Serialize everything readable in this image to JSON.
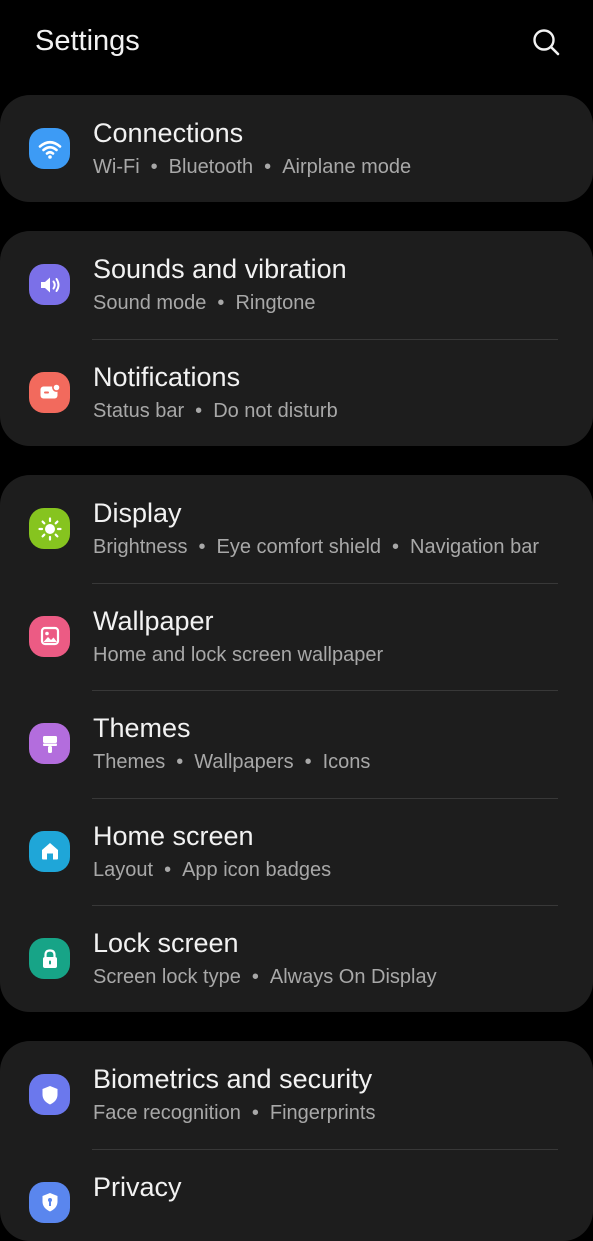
{
  "header": {
    "title": "Settings",
    "search_icon": "search-icon"
  },
  "groups": [
    {
      "items": [
        {
          "title": "Connections",
          "subtitle": [
            "Wi-Fi",
            "Bluetooth",
            "Airplane mode"
          ],
          "icon": "wifi-icon",
          "color": "#3d9bf5"
        }
      ]
    },
    {
      "items": [
        {
          "title": "Sounds and vibration",
          "subtitle": [
            "Sound mode",
            "Ringtone"
          ],
          "icon": "speaker-icon",
          "color": "#7b70e8"
        },
        {
          "title": "Notifications",
          "subtitle": [
            "Status bar",
            "Do not disturb"
          ],
          "icon": "notification-icon",
          "color": "#f26a5d"
        }
      ]
    },
    {
      "items": [
        {
          "title": "Display",
          "subtitle": [
            "Brightness",
            "Eye comfort shield",
            "Navigation bar"
          ],
          "icon": "sun-icon",
          "color": "#86c41f"
        },
        {
          "title": "Wallpaper",
          "subtitle": [
            "Home and lock screen wallpaper"
          ],
          "icon": "image-icon",
          "color": "#ec5b84"
        },
        {
          "title": "Themes",
          "subtitle": [
            "Themes",
            "Wallpapers",
            "Icons"
          ],
          "icon": "paintbrush-icon",
          "color": "#b36ddd"
        },
        {
          "title": "Home screen",
          "subtitle": [
            "Layout",
            "App icon badges"
          ],
          "icon": "home-icon",
          "color": "#1fa6d8"
        },
        {
          "title": "Lock screen",
          "subtitle": [
            "Screen lock type",
            "Always On Display"
          ],
          "icon": "lock-icon",
          "color": "#17a487"
        }
      ]
    },
    {
      "items": [
        {
          "title": "Biometrics and security",
          "subtitle": [
            "Face recognition",
            "Fingerprints"
          ],
          "icon": "shield-icon",
          "color": "#6b78ed"
        },
        {
          "title": "Privacy",
          "subtitle": [],
          "icon": "privacy-shield-icon",
          "color": "#5a86ee"
        }
      ]
    }
  ]
}
